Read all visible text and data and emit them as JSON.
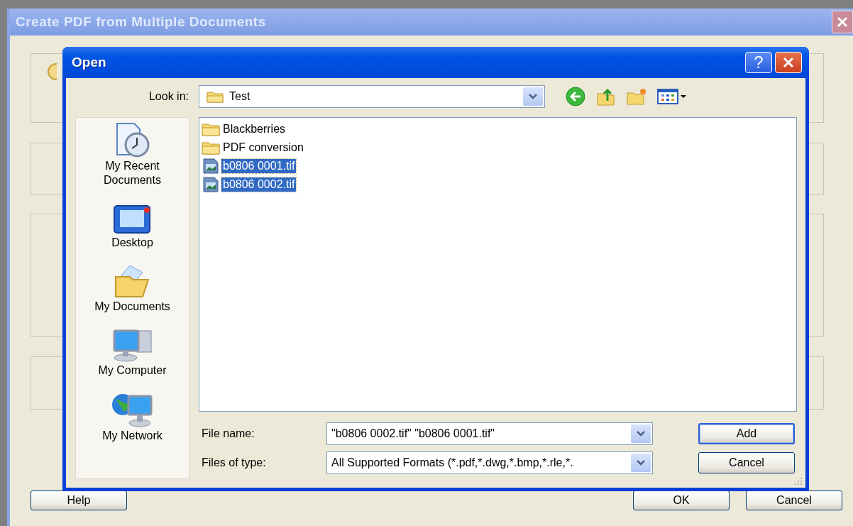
{
  "main_window": {
    "title": "Create PDF from Multiple Documents",
    "buttons": [
      {
        "label": "Help"
      },
      {
        "label": "OK"
      },
      {
        "label": "Cancel"
      }
    ]
  },
  "open_dialog": {
    "title": "Open",
    "help_glyph": "?",
    "look_in": {
      "label": "Look in:",
      "value": "Test"
    },
    "places": [
      {
        "label": "My Recent Documents",
        "kind": "recent"
      },
      {
        "label": "Desktop",
        "kind": "desktop"
      },
      {
        "label": "My Documents",
        "kind": "documents"
      },
      {
        "label": "My Computer",
        "kind": "computer"
      },
      {
        "label": "My Network",
        "kind": "network"
      }
    ],
    "files": [
      {
        "name": "Blackberries",
        "kind": "folder",
        "selected": false
      },
      {
        "name": "PDF conversion",
        "kind": "folder",
        "selected": false
      },
      {
        "name": "b0806 0001.tif",
        "kind": "image",
        "selected": true
      },
      {
        "name": "b0806 0002.tif",
        "kind": "image",
        "selected": true
      }
    ],
    "file_name": {
      "label": "File name:",
      "value": "\"b0806 0002.tif\" \"b0806 0001.tif\""
    },
    "file_type": {
      "label": "Files of type:",
      "value": "All Supported Formats (*.pdf,*.dwg,*.bmp,*.rle,*."
    },
    "buttons": [
      {
        "label": "Add",
        "default": true
      },
      {
        "label": "Cancel",
        "default": false
      }
    ]
  }
}
